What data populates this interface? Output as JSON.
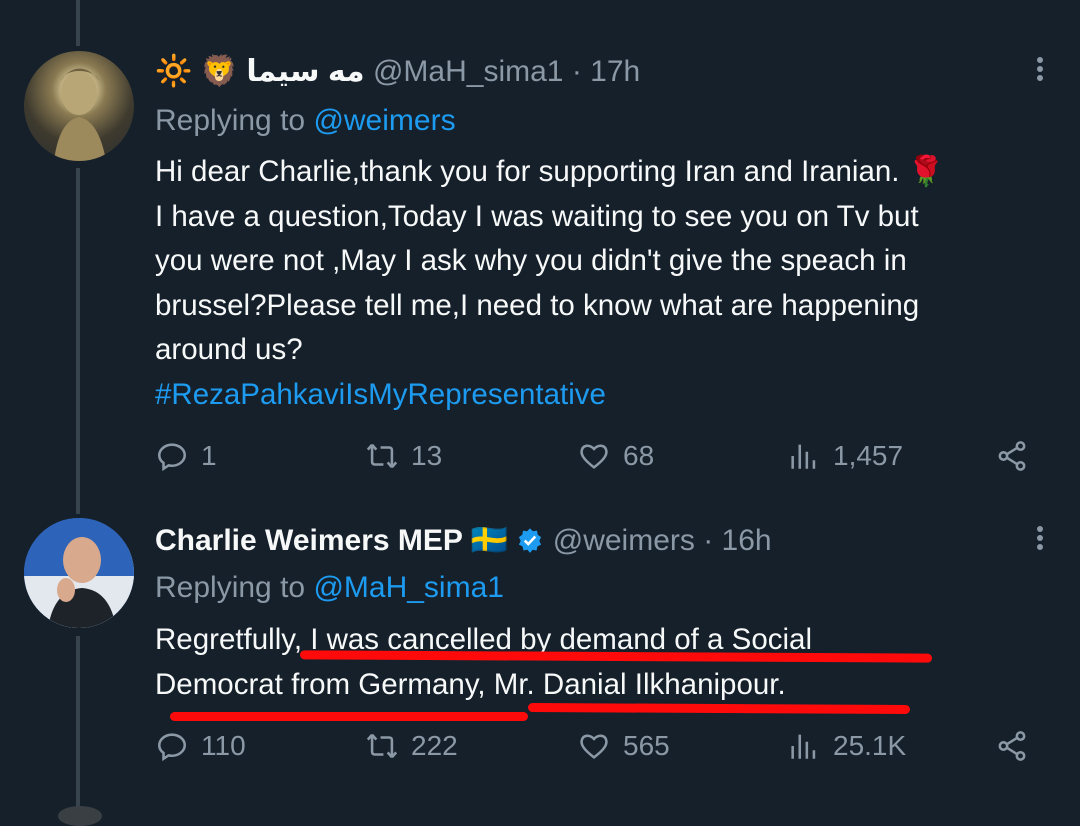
{
  "tweets": [
    {
      "display_name": "🔆 🦁 مه سیما",
      "handle": "@MaH_sima1",
      "time": " · 17h",
      "replying_label": "Replying to ",
      "replying_to": "@weimers",
      "body_lines": [
        "Hi dear Charlie,thank you for supporting Iran and Iranian. 🌹",
        "I have a question,Today I was waiting to see you on Tv but",
        "you were not ,May I ask why you didn't give the speach in",
        "brussel?Please tell me,I need to know what are happening",
        "around us?"
      ],
      "hashtag": "#RezaPahkaviIsMyRepresentative",
      "replies": "1",
      "retweets": "13",
      "likes": "68",
      "views": "1,457"
    },
    {
      "display_name": "Charlie Weimers MEP 🇸🇪",
      "handle": "@weimers",
      "time": " · 16h",
      "replying_label": "Replying to ",
      "replying_to": "@MaH_sima1",
      "body_lines": [
        "Regretfully, I was cancelled by demand of a Social",
        "Democrat from Germany, Mr. Danial Ilkhanipour."
      ],
      "replies": "110",
      "retweets": "222",
      "likes": "565",
      "views": "25.1K"
    }
  ],
  "icons": {
    "reply": "reply-icon",
    "retweet": "retweet-icon",
    "like": "heart-icon",
    "views": "views-icon",
    "share": "share-icon",
    "verified": "verified-badge-icon",
    "more": "more-icon"
  },
  "colors": {
    "background": "#15202b",
    "link": "#1d9bf0",
    "muted": "#8b98a5",
    "highlight": "#ff0a0a"
  }
}
